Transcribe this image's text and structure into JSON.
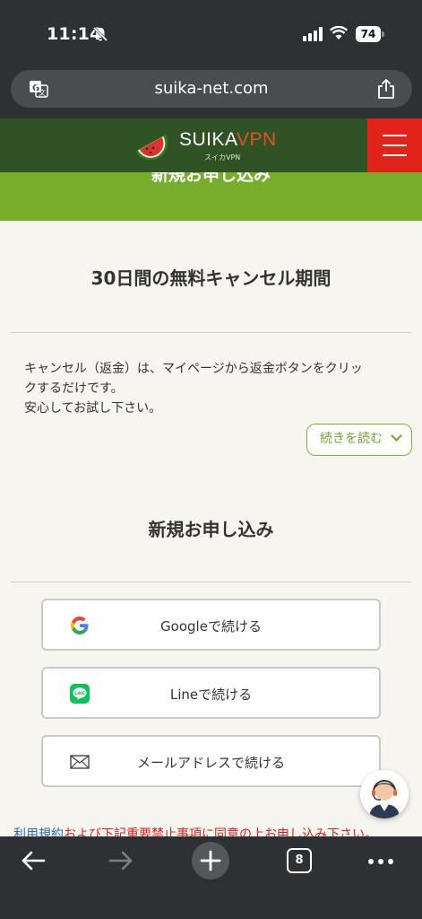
{
  "status_bar": {
    "time": "11:14",
    "battery": "74"
  },
  "browser": {
    "url": "suika-net.com",
    "tab_count": "8"
  },
  "site": {
    "logo_name": "SUIKA",
    "logo_accent": "VPN",
    "logo_sub": "スイカVPN",
    "band_title": "新規お申し込み"
  },
  "cancel_section": {
    "title": "30日間の無料キャンセル期間",
    "description_line1": "キャンセル（返金）は、マイページから返金ボタンをクリッ",
    "description_line2": "クするだけです。",
    "description_line3": "安心してお試し下さい。",
    "readmore_label": "続きを読む"
  },
  "signup_section": {
    "title": "新規お申し込み",
    "buttons": [
      {
        "label": "Googleで続ける",
        "icon": "google-icon"
      },
      {
        "label": "Lineで続ける",
        "icon": "line-icon"
      },
      {
        "label": "メールアドレスで続ける",
        "icon": "mail-icon"
      }
    ],
    "terms_link": "利用規約",
    "terms_text": "および下記重要禁止事項に同意の上お申し込み下さい。"
  },
  "colors": {
    "header_bg": "#2f5324",
    "band_green": "#78ad2c",
    "menu_red": "#e2231a",
    "accent_green": "#6fa52e",
    "terms_red": "#e02020",
    "link_blue": "#2a66c4"
  }
}
